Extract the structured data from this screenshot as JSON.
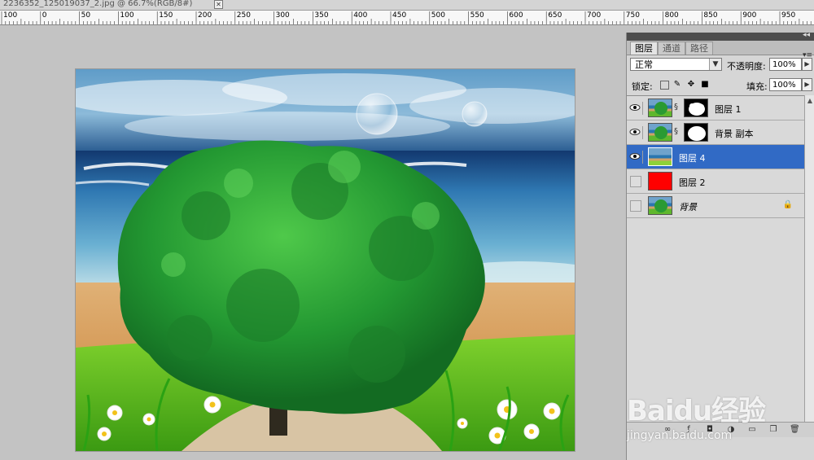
{
  "document": {
    "tab_title": "2236352_125019037_2.jpg @ 66.7%(RGB/8#)",
    "close_glyph": "✕"
  },
  "ruler": {
    "labels": [
      "100",
      "0",
      "50",
      "100",
      "150",
      "200",
      "250",
      "300",
      "350",
      "400",
      "450",
      "500",
      "550",
      "600",
      "650",
      "700",
      "750",
      "800",
      "850",
      "900",
      "950"
    ]
  },
  "layers_panel": {
    "collapse_glyph": "◂◂",
    "tabs": [
      "图层",
      "通道",
      "路径"
    ],
    "menu_glyph": "▾≡",
    "blend_mode": "正常",
    "opacity_label": "不透明度:",
    "opacity_value": "100%",
    "lock_label": "锁定:",
    "fill_label": "填充:",
    "fill_value": "100%",
    "layers": [
      {
        "name": "图层 1",
        "visible": true,
        "selected": false,
        "has_mask": true,
        "thumb": "scene",
        "locked": false
      },
      {
        "name": "背景 副本",
        "visible": true,
        "selected": false,
        "has_mask": true,
        "thumb": "scene",
        "locked": false
      },
      {
        "name": "图层 4",
        "visible": true,
        "selected": true,
        "has_mask": false,
        "thumb": "sky",
        "locked": false
      },
      {
        "name": "图层 2",
        "visible": false,
        "selected": false,
        "has_mask": false,
        "thumb": "red",
        "locked": false
      },
      {
        "name": "背景",
        "visible": false,
        "selected": false,
        "has_mask": false,
        "thumb": "scene",
        "locked": true
      }
    ],
    "selection_color": "#316ac5",
    "red_layer_color": "#ff0000"
  },
  "watermark": {
    "brand": "Baidu经验",
    "url": "jingyan.baidu.com"
  }
}
